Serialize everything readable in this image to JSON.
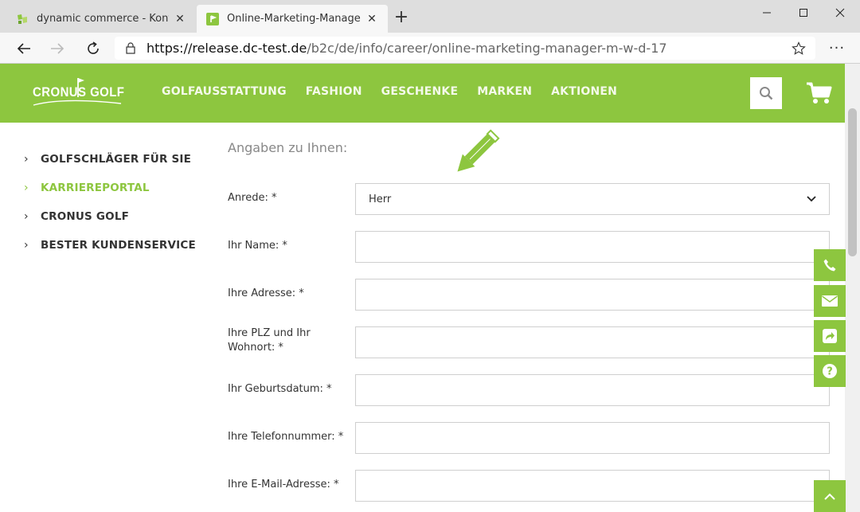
{
  "browser": {
    "tabs": [
      {
        "title": "dynamic commerce - Kontaktfor",
        "active": false
      },
      {
        "title": "Online-Marketing-Manager (m/w",
        "active": true
      }
    ],
    "new_tab": "+",
    "url_host": "https://release.dc-test.de",
    "url_path": "/b2c/de/info/career/online-marketing-manager-m-w-d-17",
    "menu": "···"
  },
  "header": {
    "logo": "CRONUS GOLF",
    "nav": [
      "GOLFAUSSTATTUNG",
      "FASHION",
      "GESCHENKE",
      "MARKEN",
      "AKTIONEN"
    ],
    "brand_color": "#8dc63f"
  },
  "sidebar": {
    "items": [
      {
        "label": "GOLFSCHLÄGER FÜR SIE",
        "active": false
      },
      {
        "label": "KARRIEREPORTAL",
        "active": true
      },
      {
        "label": "CRONUS GOLF",
        "active": false
      },
      {
        "label": "BESTER KUNDENSERVICE",
        "active": false
      }
    ]
  },
  "form": {
    "heading": "Angaben zu Ihnen:",
    "fields": [
      {
        "label": "Anrede: *",
        "value": "Herr",
        "type": "select"
      },
      {
        "label": "Ihr Name: *",
        "value": ""
      },
      {
        "label": "Ihre Adresse: *",
        "value": ""
      },
      {
        "label": "Ihre PLZ und Ihr Wohnort: *",
        "value": ""
      },
      {
        "label": "Ihr Geburtsdatum: *",
        "value": ""
      },
      {
        "label": "Ihre Telefonnummer: *",
        "value": ""
      },
      {
        "label": "Ihre E-Mail-Adresse: *",
        "value": ""
      }
    ]
  },
  "side_buttons": [
    "phone-icon",
    "envelope-icon",
    "share-icon",
    "help-icon"
  ]
}
